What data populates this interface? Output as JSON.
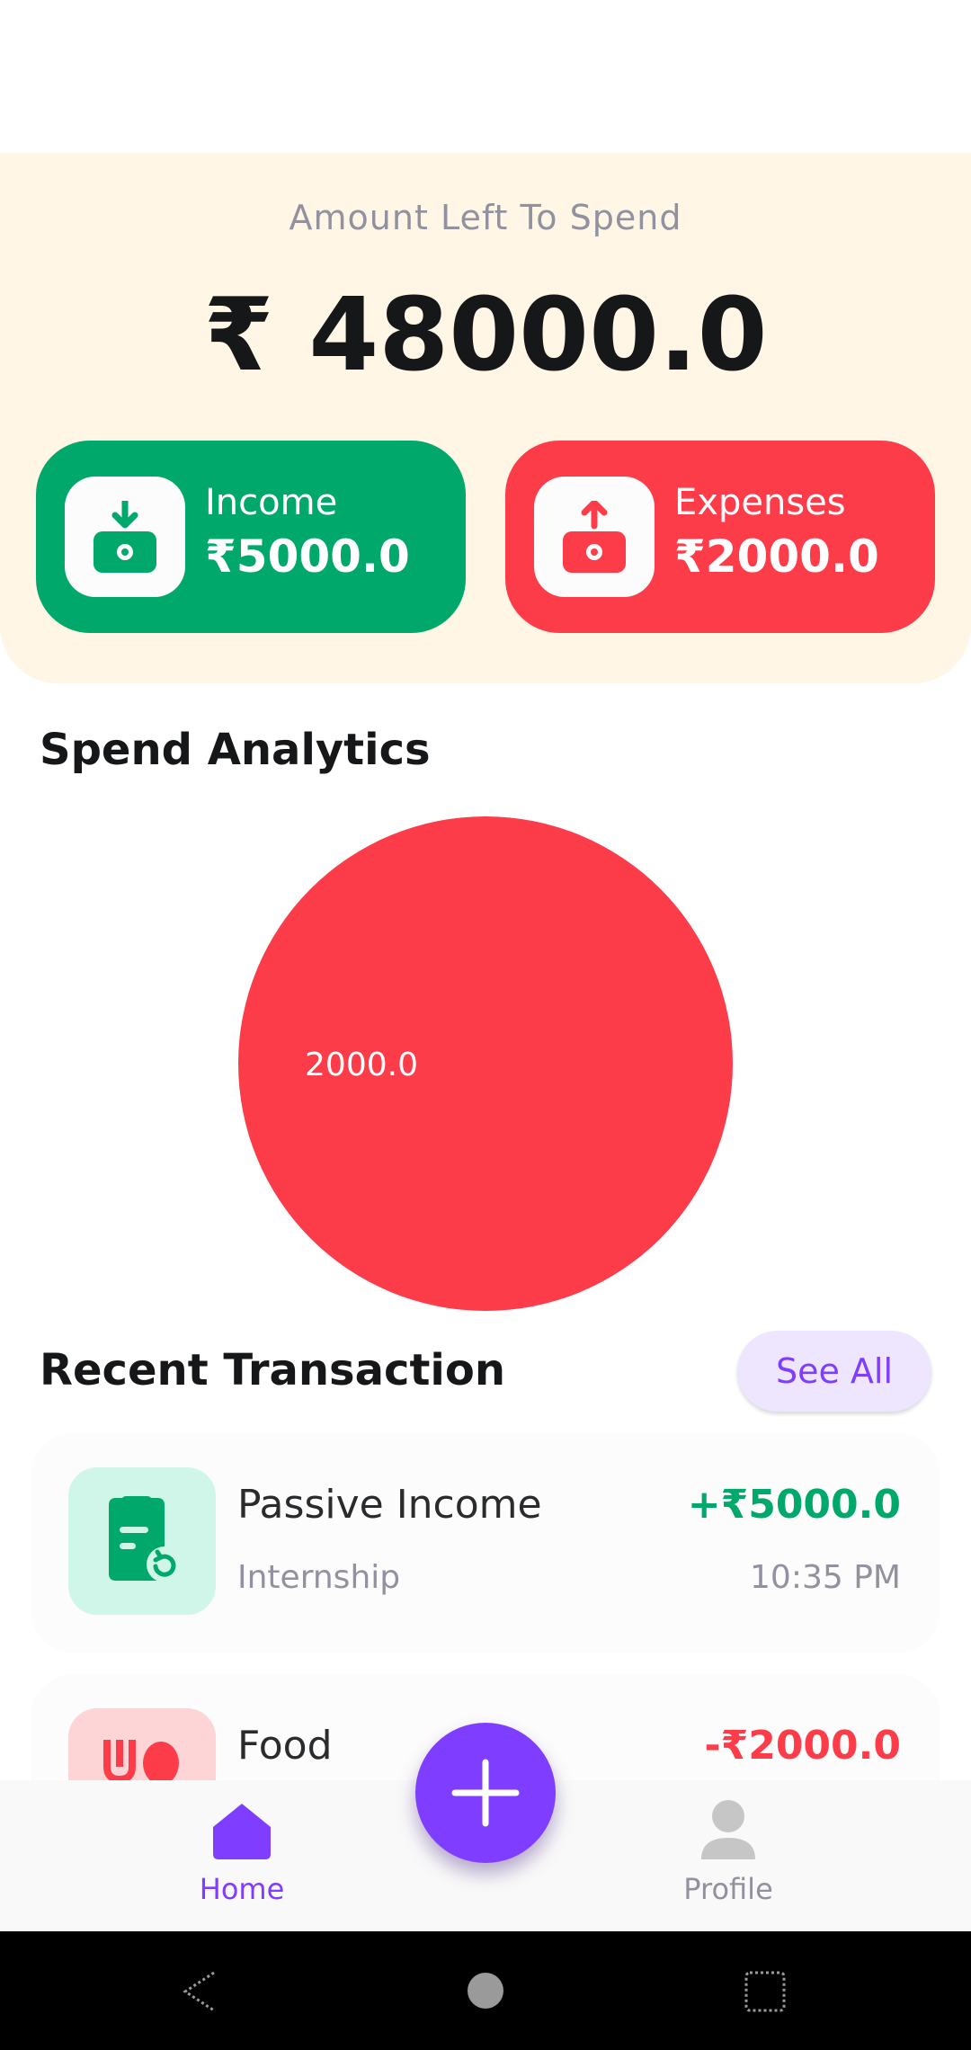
{
  "summary": {
    "label": "Amount Left To Spend",
    "balance": "₹ 48000.0",
    "income": {
      "title": "Income",
      "value": "₹5000.0"
    },
    "expenses": {
      "title": "Expenses",
      "value": "₹2000.0"
    }
  },
  "analytics": {
    "title": "Spend Analytics"
  },
  "chart_data": {
    "type": "pie",
    "categories": [
      "Food"
    ],
    "values": [
      2000.0
    ],
    "labels": [
      "2000.0"
    ],
    "colors": [
      "#fd3c4a"
    ],
    "title": "Spend Analytics"
  },
  "recent": {
    "title": "Recent Transaction",
    "see_all": "See All",
    "items": [
      {
        "title": "Passive Income",
        "subtitle": "Internship",
        "amount": "+₹5000.0",
        "time": "10:35 PM",
        "icon": "bill-refresh-icon"
      },
      {
        "title": "Food",
        "amount": "-₹2000.0",
        "icon": "restaurant-icon"
      }
    ]
  },
  "nav": {
    "home": "Home",
    "profile": "Profile"
  },
  "colors": {
    "accent": "#7f3dff",
    "income": "#00a86b",
    "expense": "#fd3c4a",
    "summary_bg": "#fff6e5"
  }
}
